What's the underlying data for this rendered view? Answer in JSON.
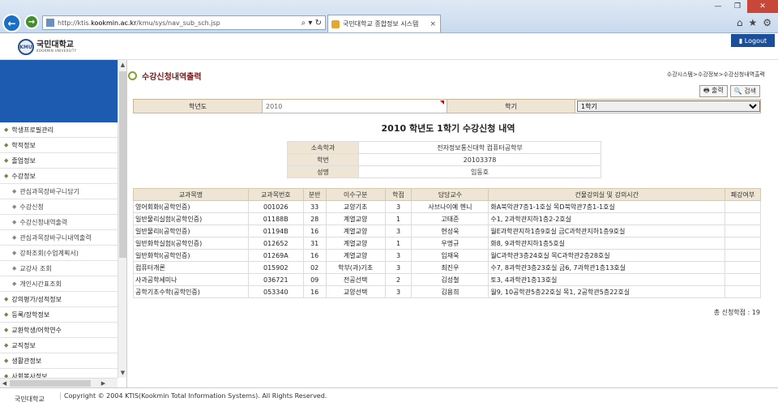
{
  "browser": {
    "url_prefix": "http://ktis.",
    "url_domain": "kookmin.ac.kr",
    "url_path": "/kmu/sys/nav_sub_sch.jsp",
    "address_controls": "⌕ ▾ ↻",
    "tab_title": "국민대학교 종합정보 시스템",
    "tab_close": "×",
    "win_min": "—",
    "win_max": "❐",
    "win_close": "✕",
    "home_icon": "⌂",
    "star_icon": "★",
    "gear_icon": "⚙",
    "back_icon": "←",
    "forward_icon": "→"
  },
  "header": {
    "logo_mark": "KMU",
    "logo_kr": "국민대학교",
    "logo_en": "KOOKMIN UNIVERSITY",
    "logout": "▮ Logout"
  },
  "sidebar": {
    "items": [
      {
        "label": "학생프로필관리",
        "sub": false
      },
      {
        "label": "학적정보",
        "sub": false
      },
      {
        "label": "졸업정보",
        "sub": false
      },
      {
        "label": "수강정보",
        "sub": false
      },
      {
        "label": "관심과목장바구니담기",
        "sub": true
      },
      {
        "label": "수강신청",
        "sub": true
      },
      {
        "label": "수강신청내역출력",
        "sub": true
      },
      {
        "label": "관심과목장바구니내역출력",
        "sub": true
      },
      {
        "label": "강좌조회(수업계획서)",
        "sub": true
      },
      {
        "label": "교강사 조회",
        "sub": true
      },
      {
        "label": "개인시간표조회",
        "sub": true
      },
      {
        "label": "강의평가/성적정보",
        "sub": false
      },
      {
        "label": "등록/장학정보",
        "sub": false
      },
      {
        "label": "교환학생/어학연수",
        "sub": false
      },
      {
        "label": "교직정보",
        "sub": false
      },
      {
        "label": "생활관정보",
        "sub": false
      },
      {
        "label": "사회봉사정보",
        "sub": false
      }
    ]
  },
  "main": {
    "page_title": "수강신청내역출력",
    "breadcrumb": "수강시스템>수강정보>수강신청내역출력",
    "print_label": "🖶 출력",
    "search_label": "🔍 검색",
    "year_label": "학년도",
    "year_value": "2010",
    "term_label": "학기",
    "term_value": "1학기",
    "report_title": "2010 학년도 1학기 수강신청 내역",
    "student": {
      "dept_label": "소속학과",
      "dept_value": "전자정보통신대학 컴퓨터공학부",
      "id_label": "학번",
      "id_value": "20103378",
      "name_label": "성명",
      "name_value": "임동호"
    },
    "table": {
      "headers": [
        "교과목명",
        "교과목번호",
        "분반",
        "이수구분",
        "학점",
        "담당교수",
        "건물강의실 및 강의시간",
        "폐강여부"
      ],
      "rows": [
        [
          "영어회화I(공학인증)",
          "001026",
          "33",
          "교양기초",
          "3",
          "사브나이예 헨니",
          "화A북악관7층1-1호실 목D북악관7층1-1호실",
          ""
        ],
        [
          "일반물리실험I(공학인증)",
          "01188B",
          "28",
          "계열교양",
          "1",
          "고태준",
          "수1, 2과학관지하1층2-2호실",
          ""
        ],
        [
          "일반물리I(공학인증)",
          "01194B",
          "16",
          "계열교양",
          "3",
          "현성욱",
          "월E과학관지하1층9호실 금C과학관지하1층9호실",
          ""
        ],
        [
          "일반화학실험I(공학인증)",
          "012652",
          "31",
          "계열교양",
          "1",
          "우명규",
          "화8, 9과학관지하1층5호실",
          ""
        ],
        [
          "일반화학I(공학인증)",
          "01269A",
          "16",
          "계열교양",
          "3",
          "임재욱",
          "월C과학관3층24호실 목C과학관2층28호실",
          ""
        ],
        [
          "컴퓨터개론",
          "015902",
          "02",
          "학부(과)기초",
          "3",
          "최진우",
          "수7, 8과학관3층23호실 금6, 7과학관1층13호실",
          ""
        ],
        [
          "사과공학세미나",
          "036721",
          "09",
          "전공선택",
          "2",
          "김성철",
          "토3, 4과학관1층13호실",
          ""
        ],
        [
          "공학기초수학(공학인증)",
          "053340",
          "16",
          "교양선택",
          "3",
          "김용희",
          "월9, 10공학관5층22호실 목1, 2공학관5층22호실",
          ""
        ]
      ]
    },
    "total_label": "총 신청학점 : 19"
  },
  "footer": {
    "left": "국민대학교",
    "copyright": "Copyright © 2004 KTIS(Kookmin Total Information Systems). All Rights Reserved."
  }
}
